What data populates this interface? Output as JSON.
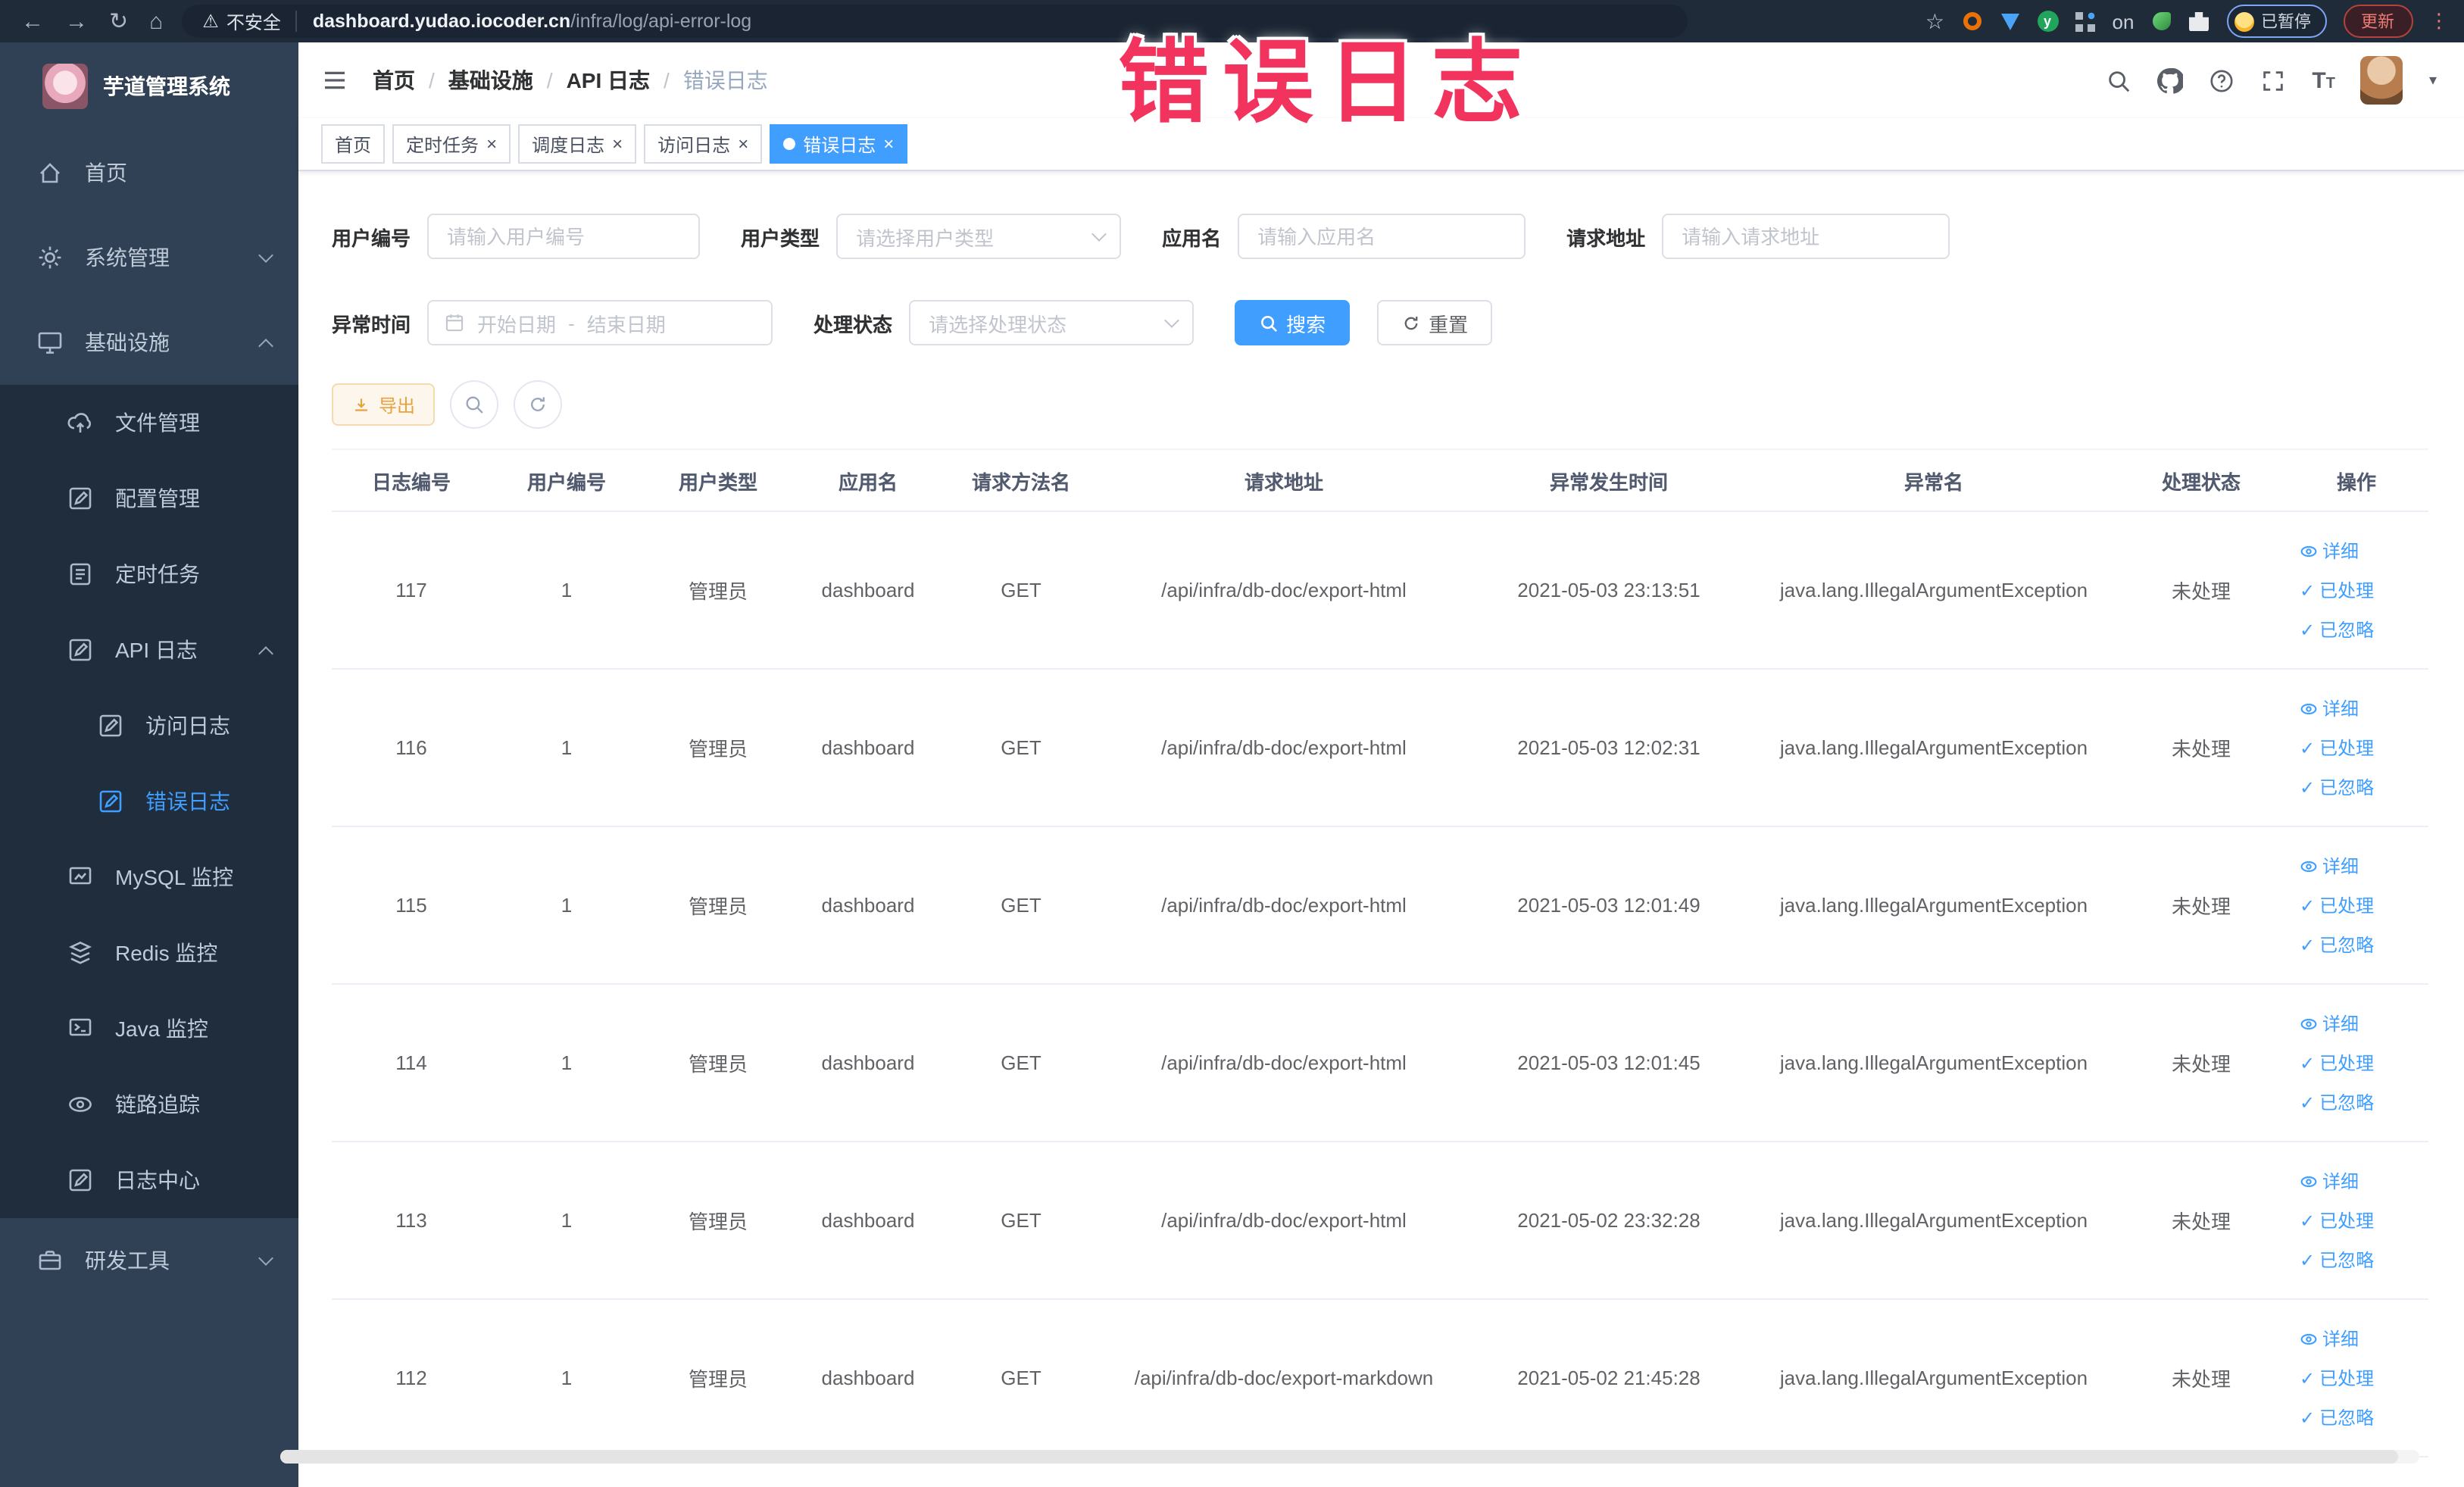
{
  "browser": {
    "security_label": "不安全",
    "url_host": "dashboard.yudao.iocoder.cn",
    "url_path": "/infra/log/api-error-log",
    "paused_label": "已暂停",
    "update_label": "更新",
    "extension_on_badge": "on"
  },
  "icons": {
    "back": "←",
    "forward": "→",
    "reload": "↻",
    "home": "⌂",
    "star": "☆",
    "kebab": "⋮",
    "warning": "⚠",
    "close": "×",
    "check": "✓",
    "caret": "▾",
    "ext_y": "y",
    "font_big": "T",
    "font_small": "T"
  },
  "watermark": {
    "text": "错误日志",
    "color": "#f2335d"
  },
  "sidebar": {
    "logo_title": "芋道管理系统",
    "items": [
      {
        "label": "首页"
      },
      {
        "label": "系统管理"
      },
      {
        "label": "基础设施"
      },
      {
        "label": "文件管理"
      },
      {
        "label": "配置管理"
      },
      {
        "label": "定时任务"
      },
      {
        "label": "API 日志"
      },
      {
        "label": "访问日志"
      },
      {
        "label": "错误日志"
      },
      {
        "label": "MySQL 监控"
      },
      {
        "label": "Redis 监控"
      },
      {
        "label": "Java 监控"
      },
      {
        "label": "链路追踪"
      },
      {
        "label": "日志中心"
      },
      {
        "label": "研发工具"
      }
    ]
  },
  "breadcrumb": {
    "separator": "/",
    "items": [
      "首页",
      "基础设施",
      "API 日志",
      "错误日志"
    ]
  },
  "tags": [
    {
      "label": "首页",
      "closable": false,
      "active": false
    },
    {
      "label": "定时任务",
      "closable": true,
      "active": false
    },
    {
      "label": "调度日志",
      "closable": true,
      "active": false
    },
    {
      "label": "访问日志",
      "closable": true,
      "active": false
    },
    {
      "label": "错误日志",
      "closable": true,
      "active": true
    }
  ],
  "filters": {
    "user_id": {
      "label": "用户编号",
      "placeholder": "请输入用户编号"
    },
    "user_type": {
      "label": "用户类型",
      "placeholder": "请选择用户类型"
    },
    "app_name": {
      "label": "应用名",
      "placeholder": "请输入应用名"
    },
    "request_url": {
      "label": "请求地址",
      "placeholder": "请输入请求地址"
    },
    "exception_time": {
      "label": "异常时间",
      "start_placeholder": "开始日期",
      "separator": "-",
      "end_placeholder": "结束日期"
    },
    "process_status": {
      "label": "处理状态",
      "placeholder": "请选择处理状态"
    },
    "search_label": "搜索",
    "reset_label": "重置"
  },
  "toolbar": {
    "export_label": "导出"
  },
  "table": {
    "columns": [
      "日志编号",
      "用户编号",
      "用户类型",
      "应用名",
      "请求方法名",
      "请求地址",
      "异常发生时间",
      "异常名",
      "处理状态",
      "操作"
    ],
    "action_labels": {
      "detail": "详细",
      "processed": "已处理",
      "ignored": "已忽略"
    },
    "rows": [
      {
        "id": "117",
        "user_id": "1",
        "user_type": "管理员",
        "app": "dashboard",
        "method": "GET",
        "url": "/api/infra/db-doc/export-html",
        "time": "2021-05-03 23:13:51",
        "exception": "java.lang.IllegalArgumentException",
        "status": "未处理"
      },
      {
        "id": "116",
        "user_id": "1",
        "user_type": "管理员",
        "app": "dashboard",
        "method": "GET",
        "url": "/api/infra/db-doc/export-html",
        "time": "2021-05-03 12:02:31",
        "exception": "java.lang.IllegalArgumentException",
        "status": "未处理"
      },
      {
        "id": "115",
        "user_id": "1",
        "user_type": "管理员",
        "app": "dashboard",
        "method": "GET",
        "url": "/api/infra/db-doc/export-html",
        "time": "2021-05-03 12:01:49",
        "exception": "java.lang.IllegalArgumentException",
        "status": "未处理"
      },
      {
        "id": "114",
        "user_id": "1",
        "user_type": "管理员",
        "app": "dashboard",
        "method": "GET",
        "url": "/api/infra/db-doc/export-html",
        "time": "2021-05-03 12:01:45",
        "exception": "java.lang.IllegalArgumentException",
        "status": "未处理"
      },
      {
        "id": "113",
        "user_id": "1",
        "user_type": "管理员",
        "app": "dashboard",
        "method": "GET",
        "url": "/api/infra/db-doc/export-html",
        "time": "2021-05-02 23:32:28",
        "exception": "java.lang.IllegalArgumentException",
        "status": "未处理"
      },
      {
        "id": "112",
        "user_id": "1",
        "user_type": "管理员",
        "app": "dashboard",
        "method": "GET",
        "url": "/api/infra/db-doc/export-markdown",
        "time": "2021-05-02 21:45:28",
        "exception": "java.lang.IllegalArgumentException",
        "status": "未处理"
      }
    ]
  },
  "colors": {
    "primary": "#409eff",
    "sidebar_bg": "#304156",
    "submenu_bg": "#1f2d3d",
    "warning": "#e6a23c",
    "watermark": "#f2335d"
  }
}
